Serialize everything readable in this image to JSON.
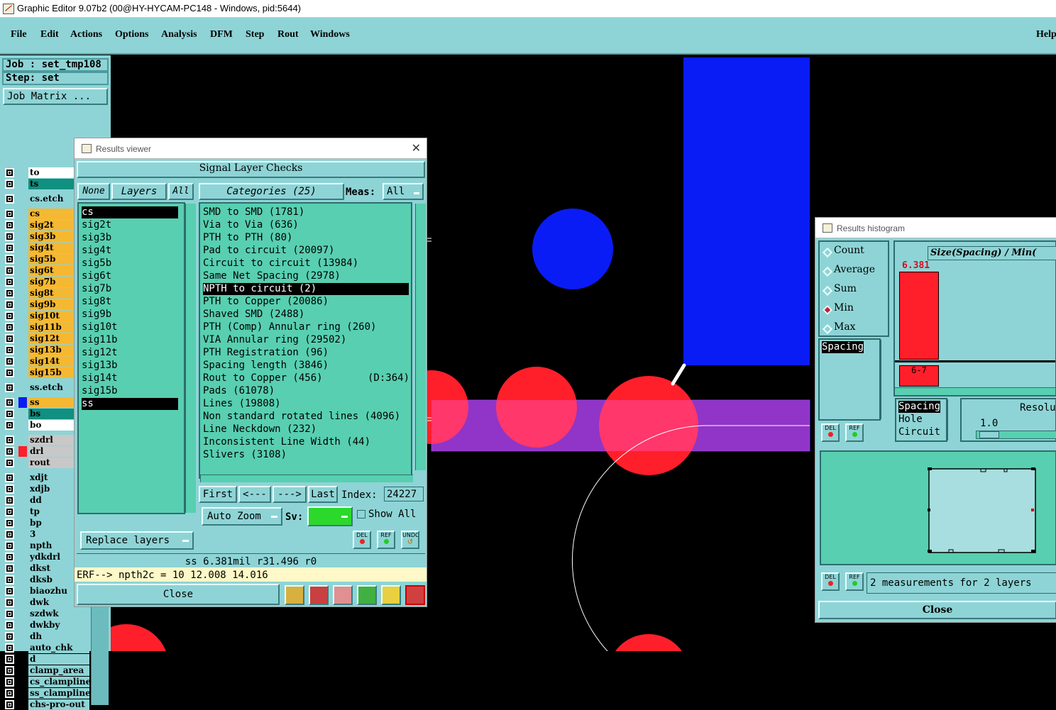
{
  "window": {
    "title": "Graphic Editor 9.07b2 (00@HY-HYCAM-PC148 - Windows, pid:5644)"
  },
  "menu": [
    "File",
    "Edit",
    "Actions",
    "Options",
    "Analysis",
    "DFM",
    "Step",
    "Rout",
    "Windows",
    "Help"
  ],
  "left": {
    "job": "Job : set_tmp108",
    "step": "Step: set",
    "job_matrix": "Job Matrix ...",
    "layers": [
      "to",
      "ts",
      "cs.etch",
      "cs",
      "sig2t",
      "sig3b",
      "sig4t",
      "sig5b",
      "sig6t",
      "sig7b",
      "sig8t",
      "sig9b",
      "sig10t",
      "sig11b",
      "sig12t",
      "sig13b",
      "sig14t",
      "sig15b",
      "ss.etch",
      "ss",
      "bs",
      "bo",
      "szdrl",
      "drl",
      "rout",
      "xdjt",
      "xdjb",
      "dd",
      "tp",
      "bp",
      "3",
      "npth",
      "ydkdrl",
      "dkst",
      "dksb",
      "biaozhu",
      "dwk",
      "szdwk",
      "dwkby",
      "dh",
      "auto_chk",
      "d",
      "clamp_area",
      "cs_clampline",
      "ss_clampline",
      "chs-pro-out"
    ]
  },
  "results_viewer": {
    "title": "Results viewer",
    "header": "Signal Layer Checks",
    "none_btn": "None",
    "layers_btn": "Layers",
    "all_btn": "All",
    "categories_btn": "Categories (25)",
    "meas_label": "Meas:",
    "meas_value": "All",
    "layer_items": [
      "cs",
      "sig2t",
      "sig3b",
      "sig4t",
      "sig5b",
      "sig6t",
      "sig7b",
      "sig8t",
      "sig9b",
      "sig10t",
      "sig11b",
      "sig12t",
      "sig13b",
      "sig14t",
      "sig15b",
      "ss"
    ],
    "categories": [
      "SMD to SMD (1781)",
      "Via to Via (636)",
      "PTH to PTH (80)",
      "Pad to circuit (20097)",
      "Circuit to circuit (13984)",
      "Same Net Spacing (2978)",
      "NPTH to circuit (2)",
      "PTH to Copper (20086)",
      "Shaved SMD (2488)",
      "PTH (Comp) Annular ring (260)",
      "VIA Annular ring (29502)",
      "PTH Registration (96)",
      "Spacing length (3846)",
      "Rout to Copper (456)",
      "Pads (61078)",
      "Lines (19808)",
      "Non standard rotated lines (4096)",
      "Line Neckdown (232)",
      "Inconsistent Line Width (44)",
      "Slivers (3108)"
    ],
    "rout_extra": "(D:364)",
    "first": "First",
    "prev": "<---",
    "next": "--->",
    "last": "Last",
    "index_label": "Index:",
    "index_value": "24227",
    "auto_zoom": "Auto Zoom",
    "sv_label": "Sv:",
    "show_all": "Show All",
    "replace_layers": "Replace layers",
    "status_line": "ss 6.381mil  r31.496  r0",
    "erf_line": "ERF--> npth2c = 10 12.008 14.016",
    "close": "Close",
    "del": "DEL",
    "ref": "REF",
    "undo": "UNDO"
  },
  "histogram": {
    "title": "Results histogram",
    "options": [
      "Count",
      "Average",
      "Sum",
      "Min",
      "Max"
    ],
    "selected": "Min",
    "list1": [
      "Spacing"
    ],
    "list2": [
      "Spacing",
      "Hole",
      "Circuit"
    ],
    "axis_title": "Size(Spacing) / Min(",
    "bar_value": "6.381",
    "bar_label": "6-7",
    "resolution_label": "Resolu",
    "resolution_value": "1.0",
    "summary": "2 measurements for 2 layers",
    "close": "Close",
    "del": "DEL",
    "ref": "REF"
  },
  "colors": {
    "panel": "#8ed4d6",
    "list": "#58cfb0",
    "pad_red": "#ff1f2a",
    "blue": "#0a1cf5"
  }
}
